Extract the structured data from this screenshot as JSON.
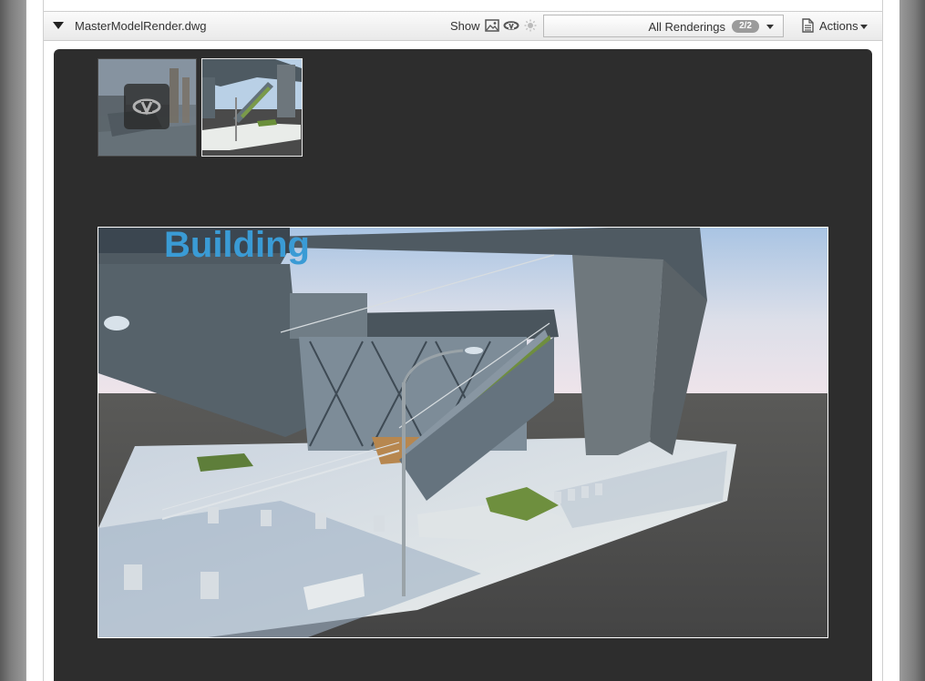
{
  "header": {
    "file_name": "MasterModelRender.dwg",
    "show_label": "Show",
    "show_icons": [
      "image-icon",
      "orbit-icon",
      "sun-icon"
    ],
    "renderings_select": {
      "label": "All Renderings",
      "badge": "2/2"
    },
    "actions_label": "Actions"
  },
  "viewer": {
    "thumbnails": [
      {
        "name": "rendering-thumbnail-1",
        "state": "dimmed",
        "overlay_icon": "orbit-icon"
      },
      {
        "name": "rendering-thumbnail-2",
        "state": "selected"
      }
    ],
    "main_render_sign_text": "Building"
  },
  "colors": {
    "viewer_background": "#2d2d2d",
    "header_background": "#eeeeee",
    "badge_background": "#9b9b9b",
    "sign_text": "#3a9bd5",
    "selected_thumbnail_border": "#e8e8e8"
  }
}
